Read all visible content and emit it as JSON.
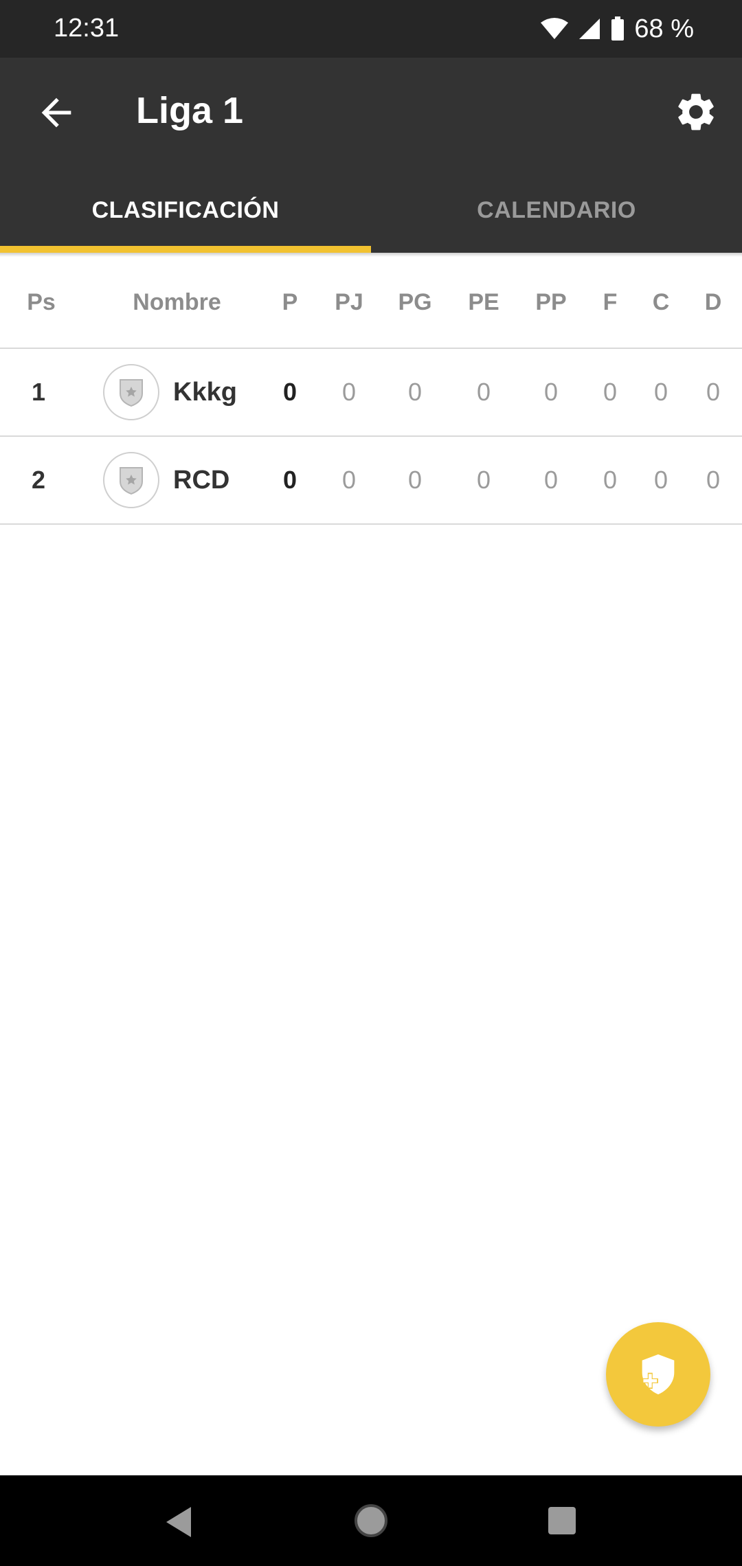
{
  "status_bar": {
    "time": "12:31",
    "battery": "68 %"
  },
  "app_bar": {
    "title": "Liga 1"
  },
  "tabs": [
    {
      "label": "CLASIFICACIÓN",
      "active": true
    },
    {
      "label": "CALENDARIO",
      "active": false
    }
  ],
  "table": {
    "headers": {
      "ps": "Ps",
      "name": "Nombre",
      "p": "P",
      "pj": "PJ",
      "pg": "PG",
      "pe": "PE",
      "pp": "PP",
      "f": "F",
      "c": "C",
      "d": "D"
    },
    "rows": [
      {
        "ps": "1",
        "name": "Kkkg",
        "p": "0",
        "pj": "0",
        "pg": "0",
        "pe": "0",
        "pp": "0",
        "f": "0",
        "c": "0",
        "d": "0"
      },
      {
        "ps": "2",
        "name": "RCD",
        "p": "0",
        "pj": "0",
        "pg": "0",
        "pe": "0",
        "pp": "0",
        "f": "0",
        "c": "0",
        "d": "0"
      }
    ]
  },
  "colors": {
    "accent": "#f2c230",
    "app_bar": "#333333",
    "status_bar": "#262626"
  },
  "icons": {
    "back": "arrow-left-icon",
    "settings": "gear-icon",
    "fab": "shield-add-icon",
    "crest": "shield-icon"
  }
}
